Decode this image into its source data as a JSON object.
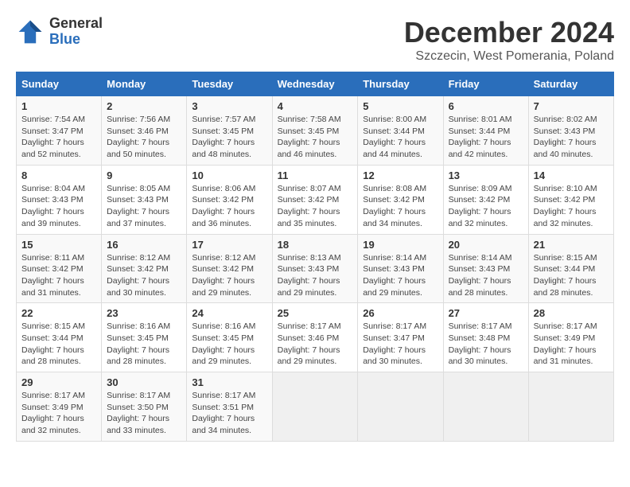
{
  "logo": {
    "general": "General",
    "blue": "Blue"
  },
  "title": "December 2024",
  "location": "Szczecin, West Pomerania, Poland",
  "weekdays": [
    "Sunday",
    "Monday",
    "Tuesday",
    "Wednesday",
    "Thursday",
    "Friday",
    "Saturday"
  ],
  "weeks": [
    [
      {
        "day": "1",
        "sunrise": "7:54 AM",
        "sunset": "3:47 PM",
        "daylight": "7 hours and 52 minutes."
      },
      {
        "day": "2",
        "sunrise": "7:56 AM",
        "sunset": "3:46 PM",
        "daylight": "7 hours and 50 minutes."
      },
      {
        "day": "3",
        "sunrise": "7:57 AM",
        "sunset": "3:45 PM",
        "daylight": "7 hours and 48 minutes."
      },
      {
        "day": "4",
        "sunrise": "7:58 AM",
        "sunset": "3:45 PM",
        "daylight": "7 hours and 46 minutes."
      },
      {
        "day": "5",
        "sunrise": "8:00 AM",
        "sunset": "3:44 PM",
        "daylight": "7 hours and 44 minutes."
      },
      {
        "day": "6",
        "sunrise": "8:01 AM",
        "sunset": "3:44 PM",
        "daylight": "7 hours and 42 minutes."
      },
      {
        "day": "7",
        "sunrise": "8:02 AM",
        "sunset": "3:43 PM",
        "daylight": "7 hours and 40 minutes."
      }
    ],
    [
      {
        "day": "8",
        "sunrise": "8:04 AM",
        "sunset": "3:43 PM",
        "daylight": "7 hours and 39 minutes."
      },
      {
        "day": "9",
        "sunrise": "8:05 AM",
        "sunset": "3:43 PM",
        "daylight": "7 hours and 37 minutes."
      },
      {
        "day": "10",
        "sunrise": "8:06 AM",
        "sunset": "3:42 PM",
        "daylight": "7 hours and 36 minutes."
      },
      {
        "day": "11",
        "sunrise": "8:07 AM",
        "sunset": "3:42 PM",
        "daylight": "7 hours and 35 minutes."
      },
      {
        "day": "12",
        "sunrise": "8:08 AM",
        "sunset": "3:42 PM",
        "daylight": "7 hours and 34 minutes."
      },
      {
        "day": "13",
        "sunrise": "8:09 AM",
        "sunset": "3:42 PM",
        "daylight": "7 hours and 32 minutes."
      },
      {
        "day": "14",
        "sunrise": "8:10 AM",
        "sunset": "3:42 PM",
        "daylight": "7 hours and 32 minutes."
      }
    ],
    [
      {
        "day": "15",
        "sunrise": "8:11 AM",
        "sunset": "3:42 PM",
        "daylight": "7 hours and 31 minutes."
      },
      {
        "day": "16",
        "sunrise": "8:12 AM",
        "sunset": "3:42 PM",
        "daylight": "7 hours and 30 minutes."
      },
      {
        "day": "17",
        "sunrise": "8:12 AM",
        "sunset": "3:42 PM",
        "daylight": "7 hours and 29 minutes."
      },
      {
        "day": "18",
        "sunrise": "8:13 AM",
        "sunset": "3:43 PM",
        "daylight": "7 hours and 29 minutes."
      },
      {
        "day": "19",
        "sunrise": "8:14 AM",
        "sunset": "3:43 PM",
        "daylight": "7 hours and 29 minutes."
      },
      {
        "day": "20",
        "sunrise": "8:14 AM",
        "sunset": "3:43 PM",
        "daylight": "7 hours and 28 minutes."
      },
      {
        "day": "21",
        "sunrise": "8:15 AM",
        "sunset": "3:44 PM",
        "daylight": "7 hours and 28 minutes."
      }
    ],
    [
      {
        "day": "22",
        "sunrise": "8:15 AM",
        "sunset": "3:44 PM",
        "daylight": "7 hours and 28 minutes."
      },
      {
        "day": "23",
        "sunrise": "8:16 AM",
        "sunset": "3:45 PM",
        "daylight": "7 hours and 28 minutes."
      },
      {
        "day": "24",
        "sunrise": "8:16 AM",
        "sunset": "3:45 PM",
        "daylight": "7 hours and 29 minutes."
      },
      {
        "day": "25",
        "sunrise": "8:17 AM",
        "sunset": "3:46 PM",
        "daylight": "7 hours and 29 minutes."
      },
      {
        "day": "26",
        "sunrise": "8:17 AM",
        "sunset": "3:47 PM",
        "daylight": "7 hours and 30 minutes."
      },
      {
        "day": "27",
        "sunrise": "8:17 AM",
        "sunset": "3:48 PM",
        "daylight": "7 hours and 30 minutes."
      },
      {
        "day": "28",
        "sunrise": "8:17 AM",
        "sunset": "3:49 PM",
        "daylight": "7 hours and 31 minutes."
      }
    ],
    [
      {
        "day": "29",
        "sunrise": "8:17 AM",
        "sunset": "3:49 PM",
        "daylight": "7 hours and 32 minutes."
      },
      {
        "day": "30",
        "sunrise": "8:17 AM",
        "sunset": "3:50 PM",
        "daylight": "7 hours and 33 minutes."
      },
      {
        "day": "31",
        "sunrise": "8:17 AM",
        "sunset": "3:51 PM",
        "daylight": "7 hours and 34 minutes."
      },
      null,
      null,
      null,
      null
    ]
  ]
}
